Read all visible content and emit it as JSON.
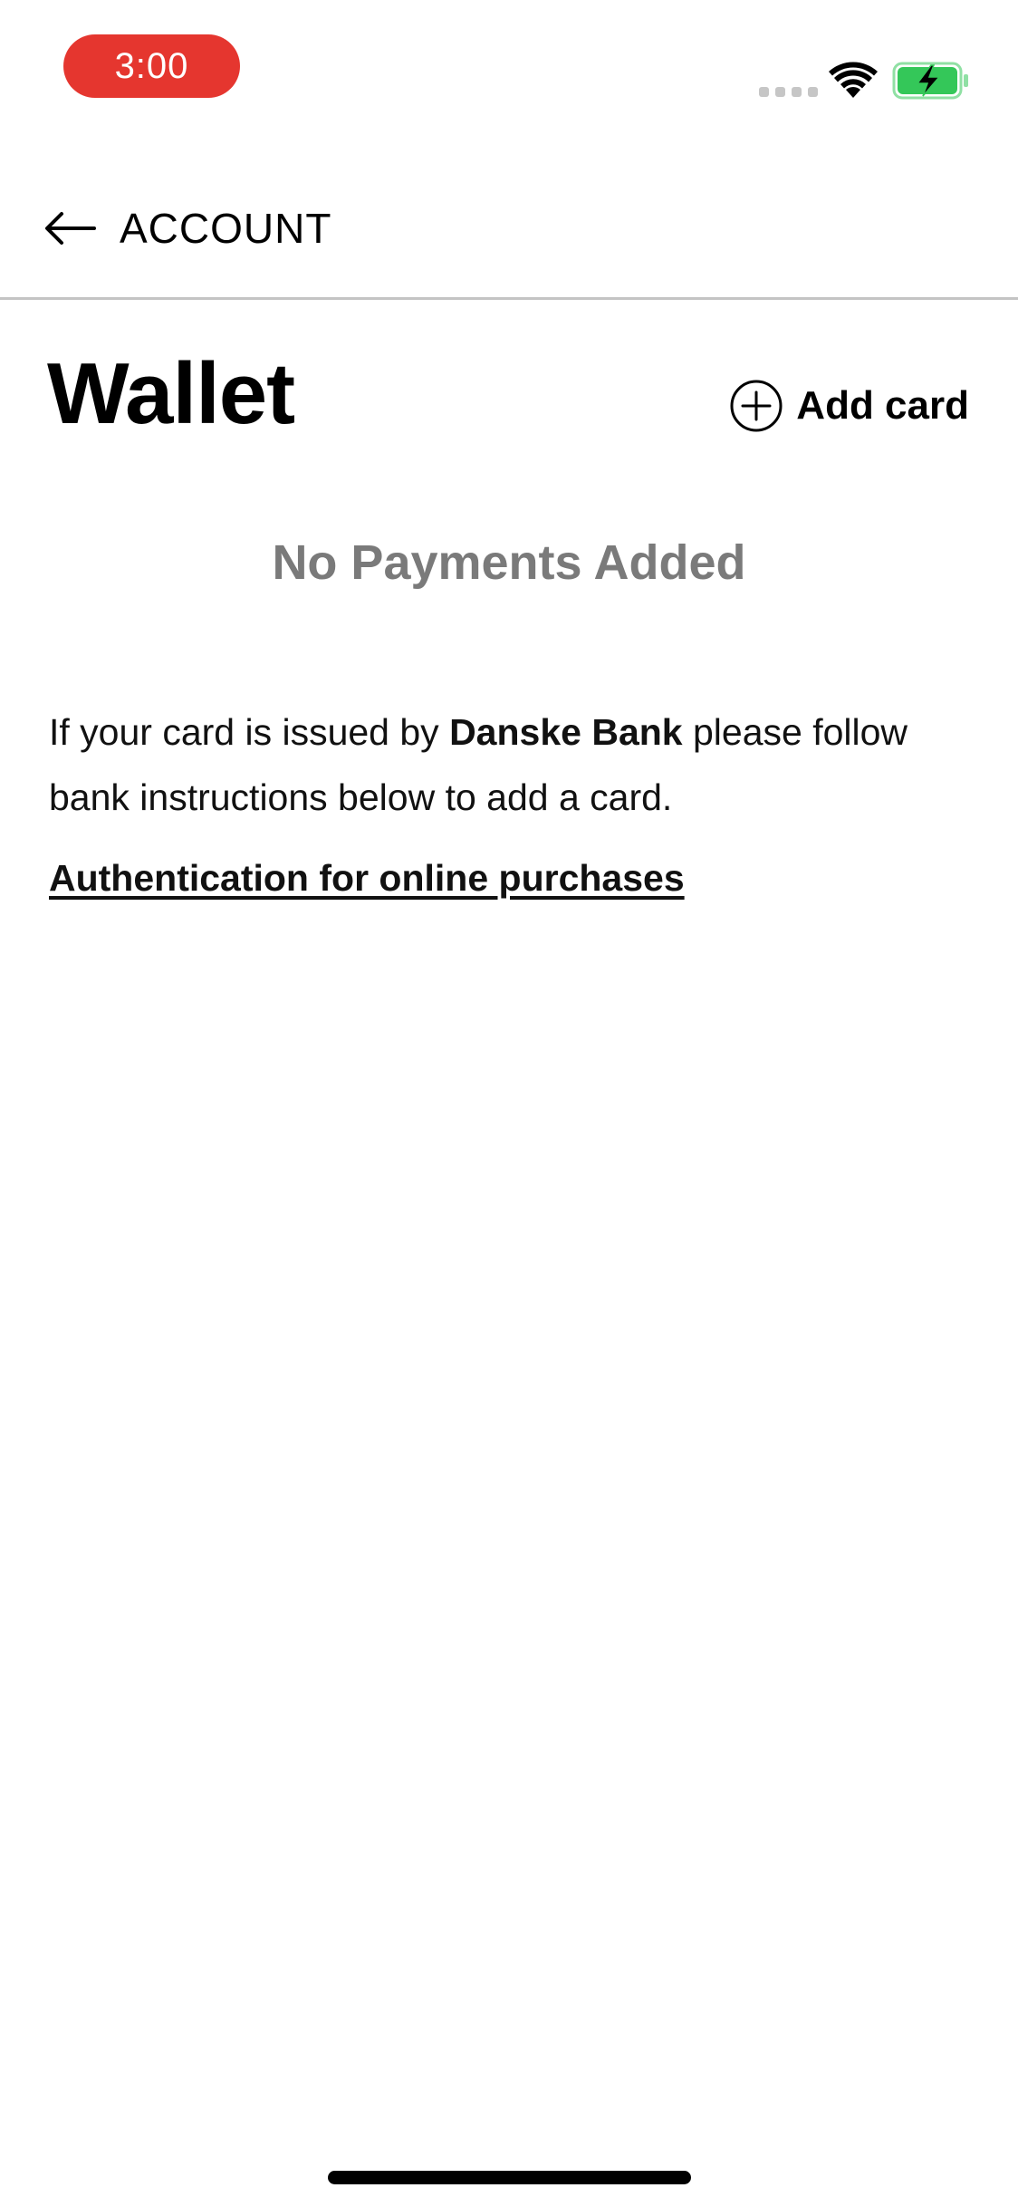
{
  "status_bar": {
    "time": "3:00",
    "signal_icon": "cellular-signal-icon",
    "wifi_icon": "wifi-icon",
    "battery_icon": "battery-charging-icon",
    "time_pill_color": "#e5362f",
    "battery_color": "#34c759"
  },
  "nav": {
    "back_icon": "arrow-left-icon",
    "back_label": "ACCOUNT"
  },
  "wallet": {
    "title": "Wallet",
    "add_card_icon": "plus-circle-icon",
    "add_card_label": "Add card",
    "empty_message": "No Payments Added",
    "info_prefix": "If your card is issued by ",
    "info_bank": "Danske Bank",
    "info_suffix": " please follow bank instructions below to add a card.",
    "auth_link": "Authentication for online purchases"
  }
}
